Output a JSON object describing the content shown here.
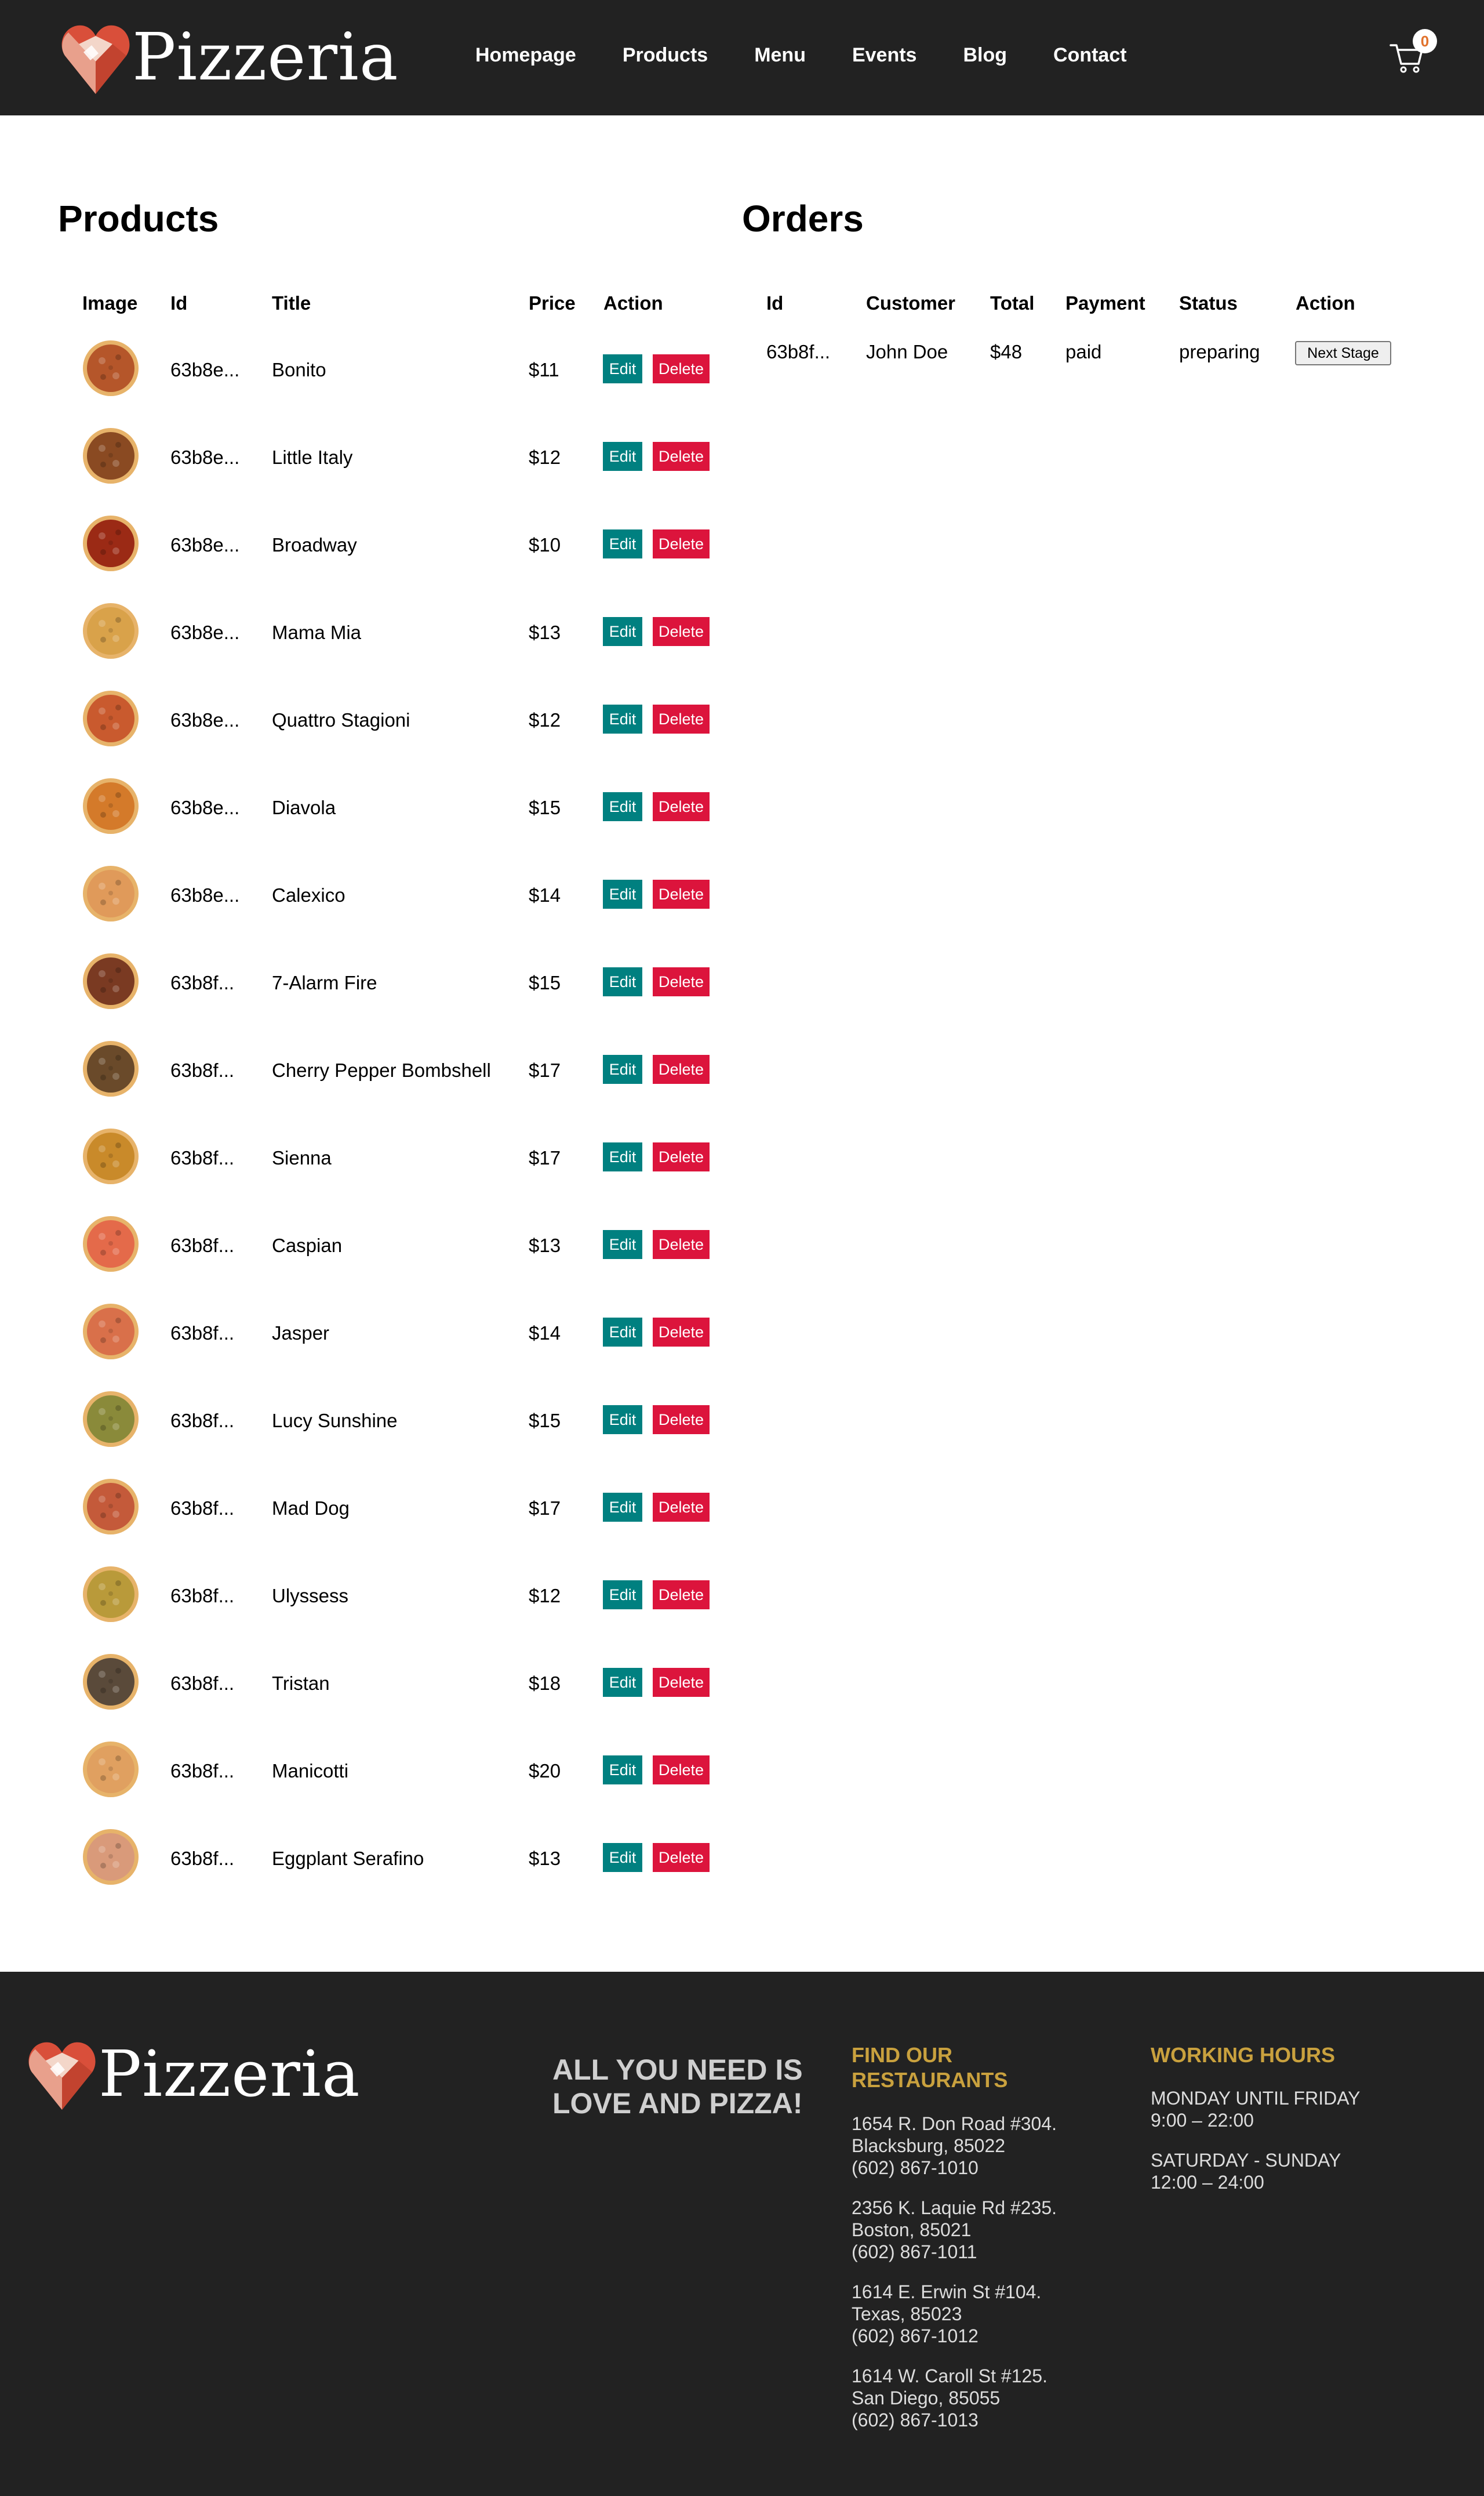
{
  "header": {
    "logo_text": "Pizzeria",
    "nav": [
      "Homepage",
      "Products",
      "Menu",
      "Events",
      "Blog",
      "Contact"
    ],
    "cart_count": "0"
  },
  "products": {
    "title": "Products",
    "columns": [
      "Image",
      "Id",
      "Title",
      "Price",
      "Action"
    ],
    "edit_label": "Edit",
    "delete_label": "Delete",
    "rows": [
      {
        "id": "63b8e...",
        "title": "Bonito",
        "price": "$11",
        "color": "#b5562a"
      },
      {
        "id": "63b8e...",
        "title": "Little Italy",
        "price": "$12",
        "color": "#8a4a22"
      },
      {
        "id": "63b8e...",
        "title": "Broadway",
        "price": "$10",
        "color": "#9b2a15"
      },
      {
        "id": "63b8e...",
        "title": "Mama Mia",
        "price": "$13",
        "color": "#d9a24a"
      },
      {
        "id": "63b8e...",
        "title": "Quattro Stagioni",
        "price": "$12",
        "color": "#c95a2e"
      },
      {
        "id": "63b8e...",
        "title": "Diavola",
        "price": "$15",
        "color": "#d47a2a"
      },
      {
        "id": "63b8e...",
        "title": "Calexico",
        "price": "$14",
        "color": "#e09a5a"
      },
      {
        "id": "63b8f...",
        "title": "7-Alarm Fire",
        "price": "$15",
        "color": "#7a3a22"
      },
      {
        "id": "63b8f...",
        "title": "Cherry Pepper Bombshell",
        "price": "$17",
        "color": "#6a4a2a"
      },
      {
        "id": "63b8f...",
        "title": "Sienna",
        "price": "$17",
        "color": "#c98a2a"
      },
      {
        "id": "63b8f...",
        "title": "Caspian",
        "price": "$13",
        "color": "#e46a4a"
      },
      {
        "id": "63b8f...",
        "title": "Jasper",
        "price": "$14",
        "color": "#d9704a"
      },
      {
        "id": "63b8f...",
        "title": "Lucy Sunshine",
        "price": "$15",
        "color": "#8a8a3a"
      },
      {
        "id": "63b8f...",
        "title": "Mad Dog",
        "price": "$17",
        "color": "#c45a3a"
      },
      {
        "id": "63b8f...",
        "title": "Ulyssess",
        "price": "$12",
        "color": "#b99a3a"
      },
      {
        "id": "63b8f...",
        "title": "Tristan",
        "price": "$18",
        "color": "#5a4a3a"
      },
      {
        "id": "63b8f...",
        "title": "Manicotti",
        "price": "$20",
        "color": "#e0a060"
      },
      {
        "id": "63b8f...",
        "title": "Eggplant Serafino",
        "price": "$13",
        "color": "#d99a7a"
      }
    ]
  },
  "orders": {
    "title": "Orders",
    "columns": [
      "Id",
      "Customer",
      "Total",
      "Payment",
      "Status",
      "Action"
    ],
    "rows": [
      {
        "id": "63b8f...",
        "customer": "John Doe",
        "total": "$48",
        "payment": "paid",
        "status": "preparing",
        "action": "Next Stage"
      }
    ]
  },
  "footer": {
    "logo_text": "Pizzeria",
    "slogan_line1": "ALL YOU NEED IS",
    "slogan_line2": "LOVE AND PIZZA!",
    "restaurants_title_line1": "FIND OUR",
    "restaurants_title_line2": "RESTAURANTS",
    "restaurants": [
      [
        "1654 R. Don Road #304.",
        "Blacksburg, 85022",
        "(602) 867-1010"
      ],
      [
        "2356 K. Laquie Rd #235.",
        "Boston, 85021",
        "(602) 867-1011"
      ],
      [
        "1614 E. Erwin St #104.",
        "Texas, 85023",
        "(602) 867-1012"
      ],
      [
        "1614 W. Caroll St #125.",
        "San Diego, 85055",
        "(602) 867-1013"
      ]
    ],
    "hours_title": "WORKING HOURS",
    "hours": [
      [
        "MONDAY UNTIL FRIDAY",
        "9:00 – 22:00"
      ],
      [
        "SATURDAY - SUNDAY",
        "12:00 – 24:00"
      ]
    ]
  }
}
